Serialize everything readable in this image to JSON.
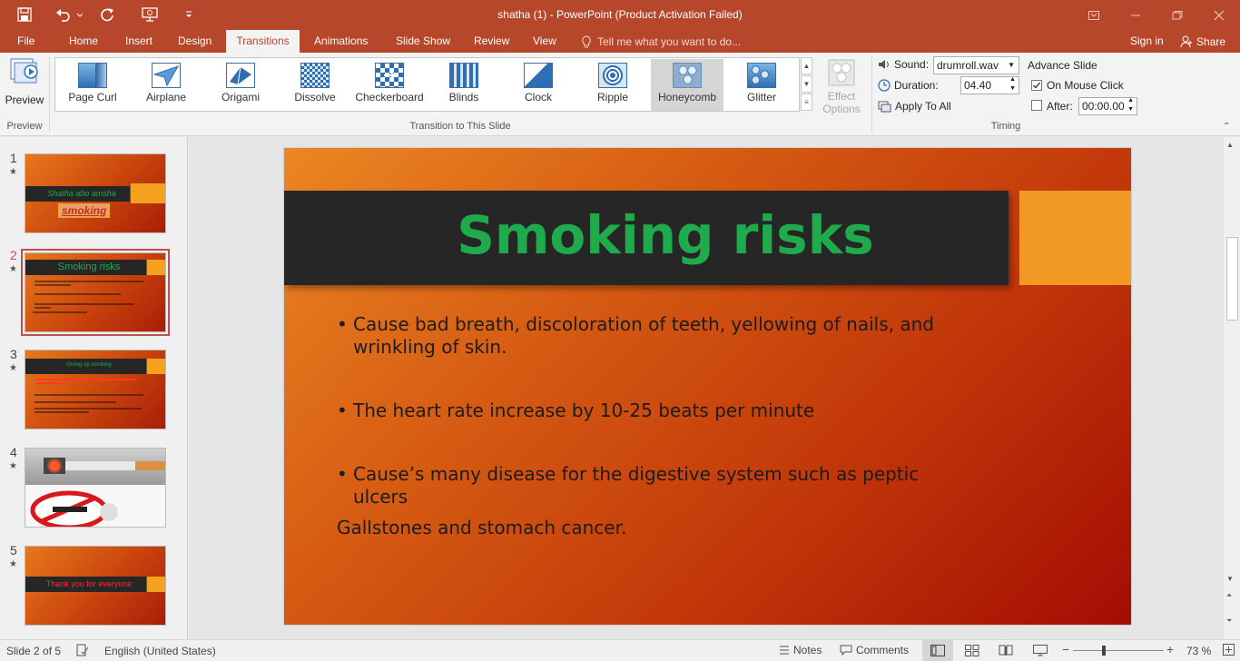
{
  "window": {
    "title": "shatha (1) - PowerPoint (Product Activation Failed)"
  },
  "tabs": [
    {
      "label": "File"
    },
    {
      "label": "Home"
    },
    {
      "label": "Insert"
    },
    {
      "label": "Design"
    },
    {
      "label": "Transitions"
    },
    {
      "label": "Animations"
    },
    {
      "label": "Slide Show"
    },
    {
      "label": "Review"
    },
    {
      "label": "View"
    }
  ],
  "tell_me": "Tell me what you want to do...",
  "sign_in": "Sign in",
  "share": "Share",
  "ribbon": {
    "preview_label": "Preview",
    "preview_group": "Preview",
    "transitions": [
      {
        "label": "Page Curl",
        "icon": "page-curl-icon"
      },
      {
        "label": "Airplane",
        "icon": "airplane-icon"
      },
      {
        "label": "Origami",
        "icon": "origami-icon"
      },
      {
        "label": "Dissolve",
        "icon": "dissolve-icon"
      },
      {
        "label": "Checkerboard",
        "icon": "checkerboard-icon"
      },
      {
        "label": "Blinds",
        "icon": "blinds-icon"
      },
      {
        "label": "Clock",
        "icon": "clock-icon"
      },
      {
        "label": "Ripple",
        "icon": "ripple-icon"
      },
      {
        "label": "Honeycomb",
        "icon": "honeycomb-icon",
        "selected": true
      },
      {
        "label": "Glitter",
        "icon": "glitter-icon"
      }
    ],
    "transition_group": "Transition to This Slide",
    "effect_options_1": "Effect",
    "effect_options_2": "Options",
    "timing": {
      "sound_label": "Sound:",
      "sound_value": "drumroll.wav",
      "duration_label": "Duration:",
      "duration_value": "04.40",
      "apply_all": "Apply To All",
      "advance_label": "Advance Slide",
      "on_mouse_click": "On Mouse Click",
      "on_mouse_click_checked": true,
      "after_label": "After:",
      "after_value": "00:00.00",
      "after_checked": false,
      "group": "Timing"
    }
  },
  "thumbnails": [
    {
      "num": "1",
      "title": "Shatha abo amsha",
      "subtitle": "smoking"
    },
    {
      "num": "2",
      "title": "Smoking risks",
      "selected": true
    },
    {
      "num": "3",
      "title": "Giving up smoking"
    },
    {
      "num": "4"
    },
    {
      "num": "5",
      "title": "Thank you for everyone"
    }
  ],
  "slide": {
    "title": "Smoking risks",
    "bullets": [
      {
        "bullet": "•",
        "line1": "Cause bad breath, discoloration of teeth, yellowing of nails, and",
        "line2": "wrinkling of skin."
      },
      {
        "bullet": "•",
        "line1": "The heart rate increase by 10-25  beats per minute",
        "line2": ""
      },
      {
        "bullet": "•",
        "line1": "Cause’s many disease for the digestive system such as peptic",
        "line2": "ulcers"
      }
    ],
    "extra_line": "Gallstones and stomach cancer."
  },
  "status": {
    "slide_info": "Slide 2 of 5",
    "language": "English (United States)",
    "notes": "Notes",
    "comments": "Comments",
    "zoom": "73 %"
  },
  "colors": {
    "accent": "#b7472a",
    "slide_title": "#1fab4b",
    "slide_square": "#f09a23",
    "slide_bar": "#262626"
  }
}
